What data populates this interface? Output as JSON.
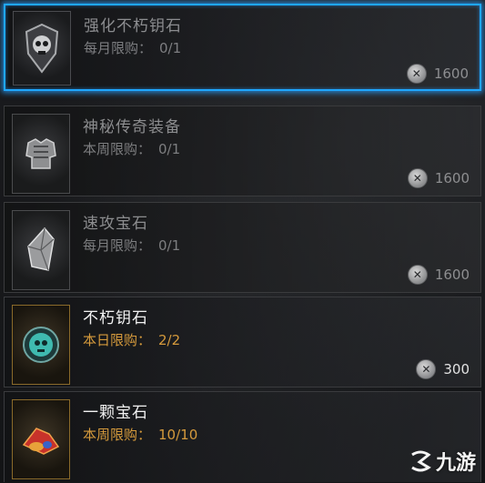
{
  "shop_items": [
    {
      "name": "强化不朽钥石",
      "limit_label": "每月限购：",
      "limit_value": "0/1",
      "price": "1600",
      "icon": "shield-skull-icon",
      "state": "selected"
    },
    {
      "name": "神秘传奇装备",
      "limit_label": "本周限购：",
      "limit_value": "0/1",
      "price": "1600",
      "icon": "armor-chest-icon",
      "state": "locked"
    },
    {
      "name": "速攻宝石",
      "limit_label": "每月限购：",
      "limit_value": "0/1",
      "price": "1600",
      "icon": "crystal-gem-icon",
      "state": "locked"
    },
    {
      "name": "不朽钥石",
      "limit_label": "本日限购：",
      "limit_value": "2/2",
      "price": "300",
      "icon": "glowing-keystone-icon",
      "state": "available"
    },
    {
      "name": "一颗宝石",
      "limit_label": "本周限购：",
      "limit_value": "10/10",
      "price": "",
      "icon": "red-gem-icon",
      "state": "available"
    }
  ],
  "currency_icon": "platinum-coin-icon",
  "watermark": {
    "text": "九游",
    "logo": "jiuyou-logo-icon"
  },
  "colors": {
    "selected_border": "#1fa7ff",
    "limit_active": "#d59a3c",
    "title_locked": "#8c8d90"
  }
}
